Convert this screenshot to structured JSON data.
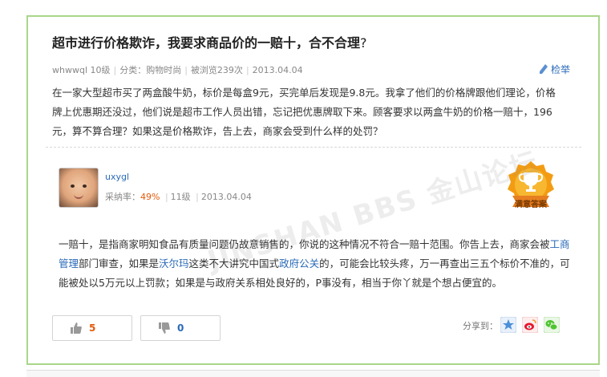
{
  "question": {
    "title": "超市进行价格欺诈，我要求商品价的一赔十，合不合理",
    "title_qmark": "?",
    "author": "whwwql",
    "level": "10级",
    "category": "分类：购物时尚",
    "views": "被浏览239次",
    "date": "2013.04.04",
    "report_label": "检举",
    "body": "在一家大型超市买了两盒酸牛奶，标价是每盒9元，买完单后发现是9.8元。我拿了他们的价格牌跟他们理论，价格牌上优惠期还没过，他们说是超市工作人员出错，忘记把优惠牌取下来。顾客要求以两盒牛奶的价格一赔十，196元，算不算合理？如果这是价格欺诈，告上去，商家会受到什么样的处罚？"
  },
  "answer": {
    "username": "uxygl",
    "rate_label": "采纳率：",
    "rate_value": "49%",
    "level": "11级",
    "date": "2013.04.04",
    "badge_text": "满意答案",
    "watermark": "JINSHAN BBS 金山论坛",
    "body_seg1": "一赔十，是指商家明知食品有质量问题仍故意销售的，你说的这种情况不符合一赔十范围。你告上去，商家会被",
    "link1": "工商管理",
    "body_seg2": "部门审查，如果是",
    "link2": "沃尔玛",
    "body_seg3": "这类不大讲究中国式",
    "link3": "政府公关",
    "body_seg4": "的，可能会比较头疼，万一再查出三五个标价不准的，可能被处以5万元以上罚款；如果是与政府关系相处良好的，P事没有，相当于你丫就是个想占便宜的。"
  },
  "actions": {
    "up_count": "5",
    "down_count": "0",
    "share_label": "分享到："
  },
  "icons": [
    "pen-icon",
    "thumbs-up-icon",
    "thumbs-down-icon",
    "qzone-icon",
    "weibo-icon",
    "wechat-icon",
    "trophy-icon"
  ],
  "colors": {
    "frame_border": "#a9d68a",
    "link": "#2a6ab8",
    "rate": "#e25a0b",
    "badge_orange": "#f39c12"
  }
}
